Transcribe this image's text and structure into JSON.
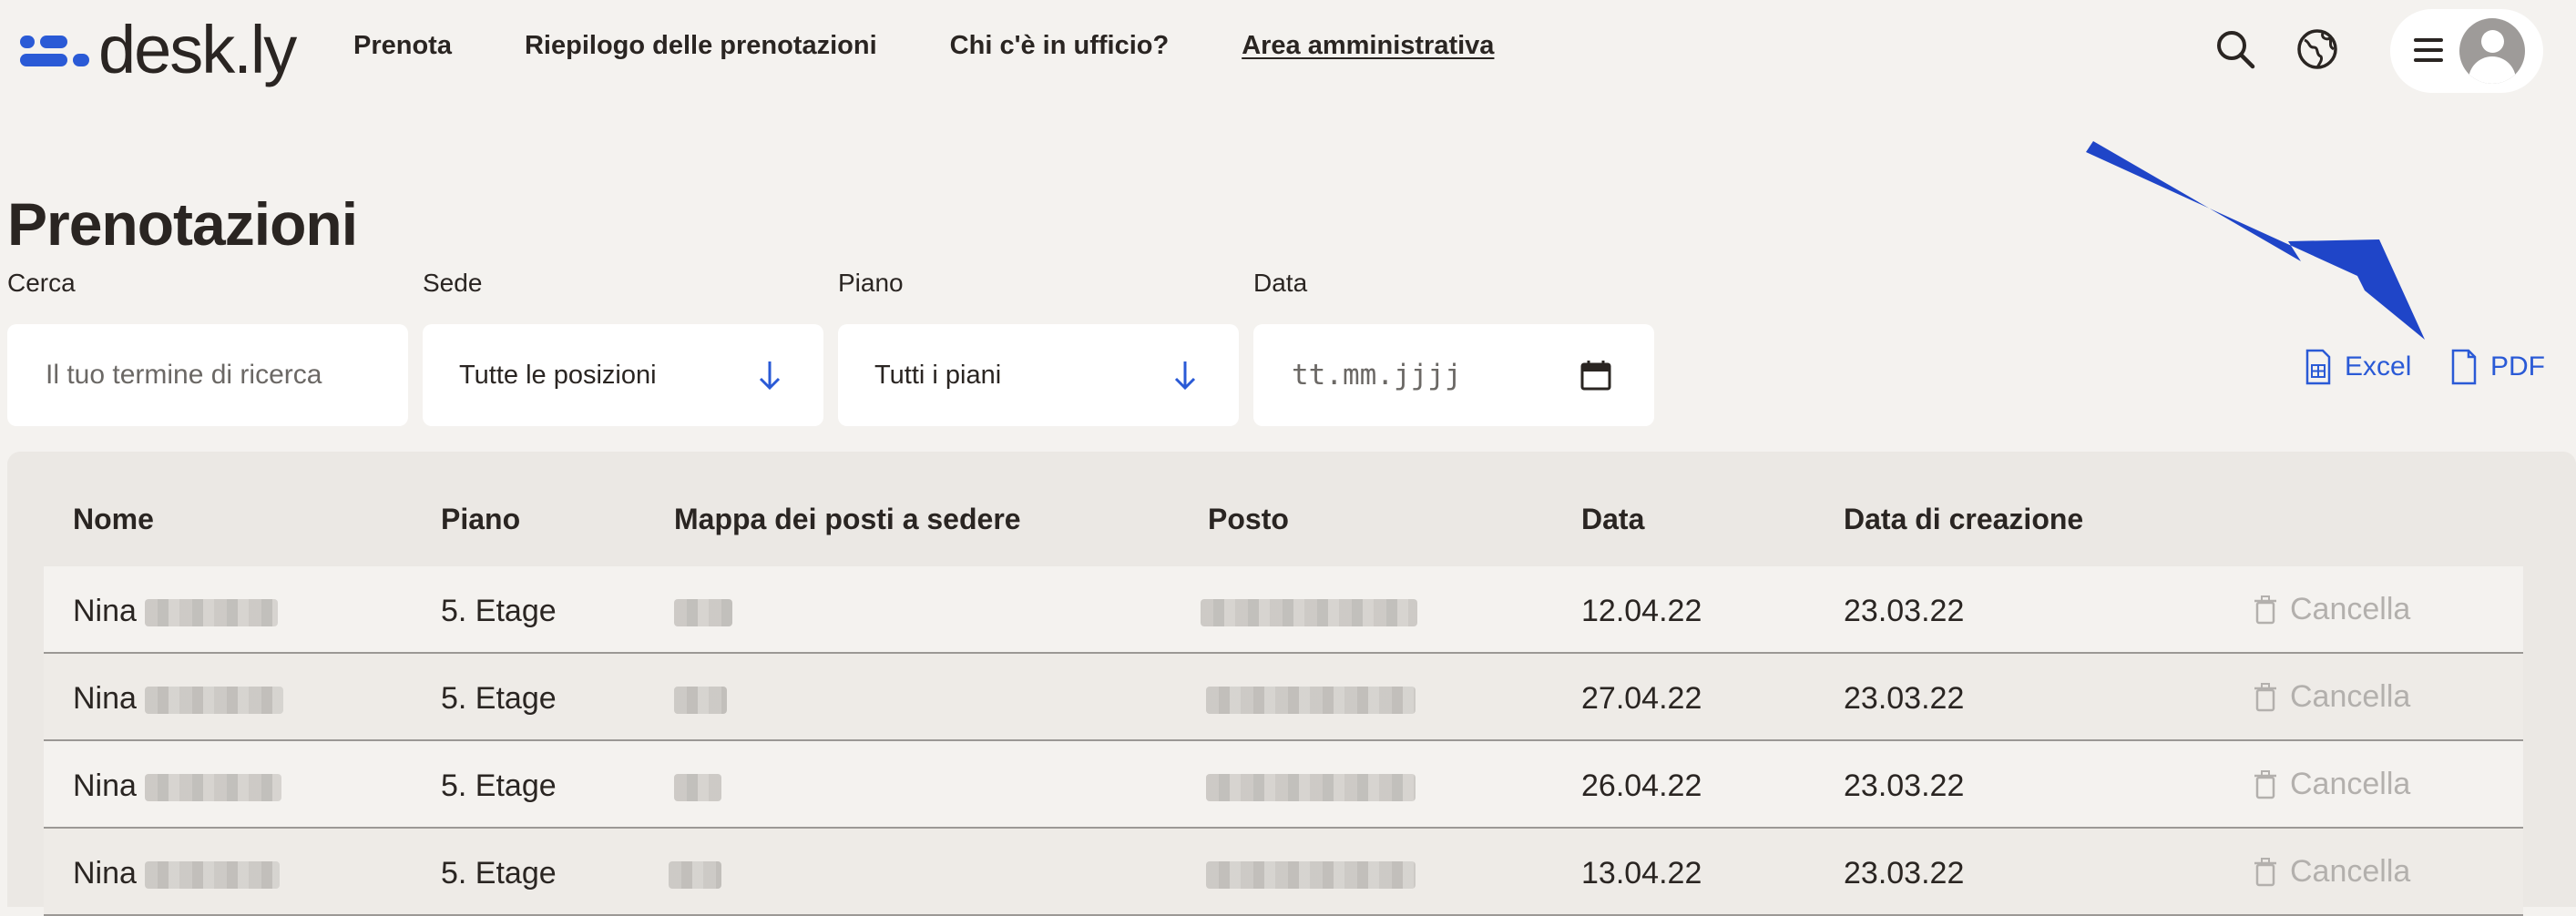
{
  "app": {
    "logo_text": "desk.ly"
  },
  "nav": [
    {
      "label": "Prenota"
    },
    {
      "label": "Riepilogo delle prenotazioni"
    },
    {
      "label": "Chi c'è in ufficio?"
    },
    {
      "label": "Area amministrativa",
      "active": true
    }
  ],
  "header_icons": [
    "search-icon",
    "globe-icon",
    "menu-icon",
    "avatar"
  ],
  "page": {
    "title": "Prenotazioni"
  },
  "filters": {
    "search": {
      "label": "Cerca",
      "placeholder": "Il tuo termine di ricerca"
    },
    "location": {
      "label": "Sede",
      "value": "Tutte le posizioni"
    },
    "floor": {
      "label": "Piano",
      "value": "Tutti i piani"
    },
    "date": {
      "label": "Data",
      "placeholder": "tt.mm.jjjj"
    }
  },
  "export": {
    "excel_label": "Excel",
    "pdf_label": "PDF"
  },
  "table": {
    "headers": [
      "Nome",
      "Piano",
      "Mappa dei posti a sedere",
      "Posto",
      "Data",
      "Data di creazione"
    ],
    "delete_label": "Cancella",
    "rows": [
      {
        "name": "Nina",
        "floor": "5. Etage",
        "date": "12.04.22",
        "created": "23.03.22"
      },
      {
        "name": "Nina",
        "floor": "5. Etage",
        "date": "27.04.22",
        "created": "23.03.22"
      },
      {
        "name": "Nina",
        "floor": "5. Etage",
        "date": "26.04.22",
        "created": "23.03.22"
      },
      {
        "name": "Nina",
        "floor": "5. Etage",
        "date": "13.04.22",
        "created": "23.03.22"
      }
    ]
  },
  "colors": {
    "accent": "#2a5ad6",
    "background": "#f4f2ef",
    "panel": "#ebe8e4",
    "muted": "#b3b0ad"
  }
}
